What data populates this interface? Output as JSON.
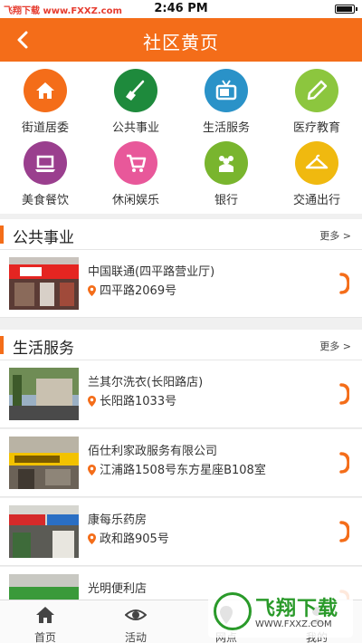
{
  "status_bar": {
    "watermark": "飞翔下载 www.FXXZ.com",
    "time": "2:46 PM"
  },
  "header": {
    "title": "社区黄页"
  },
  "categories": [
    {
      "label": "街道居委",
      "icon": "home-icon",
      "color": "#f46d19"
    },
    {
      "label": "公共事业",
      "icon": "broom-icon",
      "color": "#1e8a3c"
    },
    {
      "label": "生活服务",
      "icon": "tv-icon",
      "color": "#2a92c8"
    },
    {
      "label": "医疗教育",
      "icon": "pen-icon",
      "color": "#8cc63e"
    },
    {
      "label": "美食餐饮",
      "icon": "laptop-icon",
      "color": "#9a3f8e"
    },
    {
      "label": "休闲娱乐",
      "icon": "cart-icon",
      "color": "#e8589a"
    },
    {
      "label": "银行",
      "icon": "people-icon",
      "color": "#79b52e"
    },
    {
      "label": "交通出行",
      "icon": "hanger-icon",
      "color": "#f0b90f"
    }
  ],
  "sections": [
    {
      "name": "公共事业",
      "more": "更多 >",
      "items": [
        {
          "name": "中国联通(四平路营业厅)",
          "address": "四平路2069号"
        }
      ]
    },
    {
      "name": "生活服务",
      "more": "更多 >",
      "items": [
        {
          "name": "兰其尔洗衣(长阳路店)",
          "address": "长阳路1033号"
        },
        {
          "name": "佰仕利家政服务有限公司",
          "address": "江浦路1508号东方星座B108室"
        },
        {
          "name": "康每乐药房",
          "address": "政和路905号"
        },
        {
          "name": "光明便利店",
          "address": ""
        }
      ]
    }
  ],
  "tabs": [
    {
      "label": "首页",
      "icon": "home-icon"
    },
    {
      "label": "活动",
      "icon": "eye-icon"
    },
    {
      "label": "网点",
      "icon": "map-icon"
    },
    {
      "label": "我的",
      "icon": "user-icon"
    }
  ],
  "corner_watermark": {
    "title": "飞翔下载",
    "url": "WWW.FXXZ.COM"
  },
  "colors": {
    "accent": "#f46d19",
    "background": "#f0f0f0"
  }
}
